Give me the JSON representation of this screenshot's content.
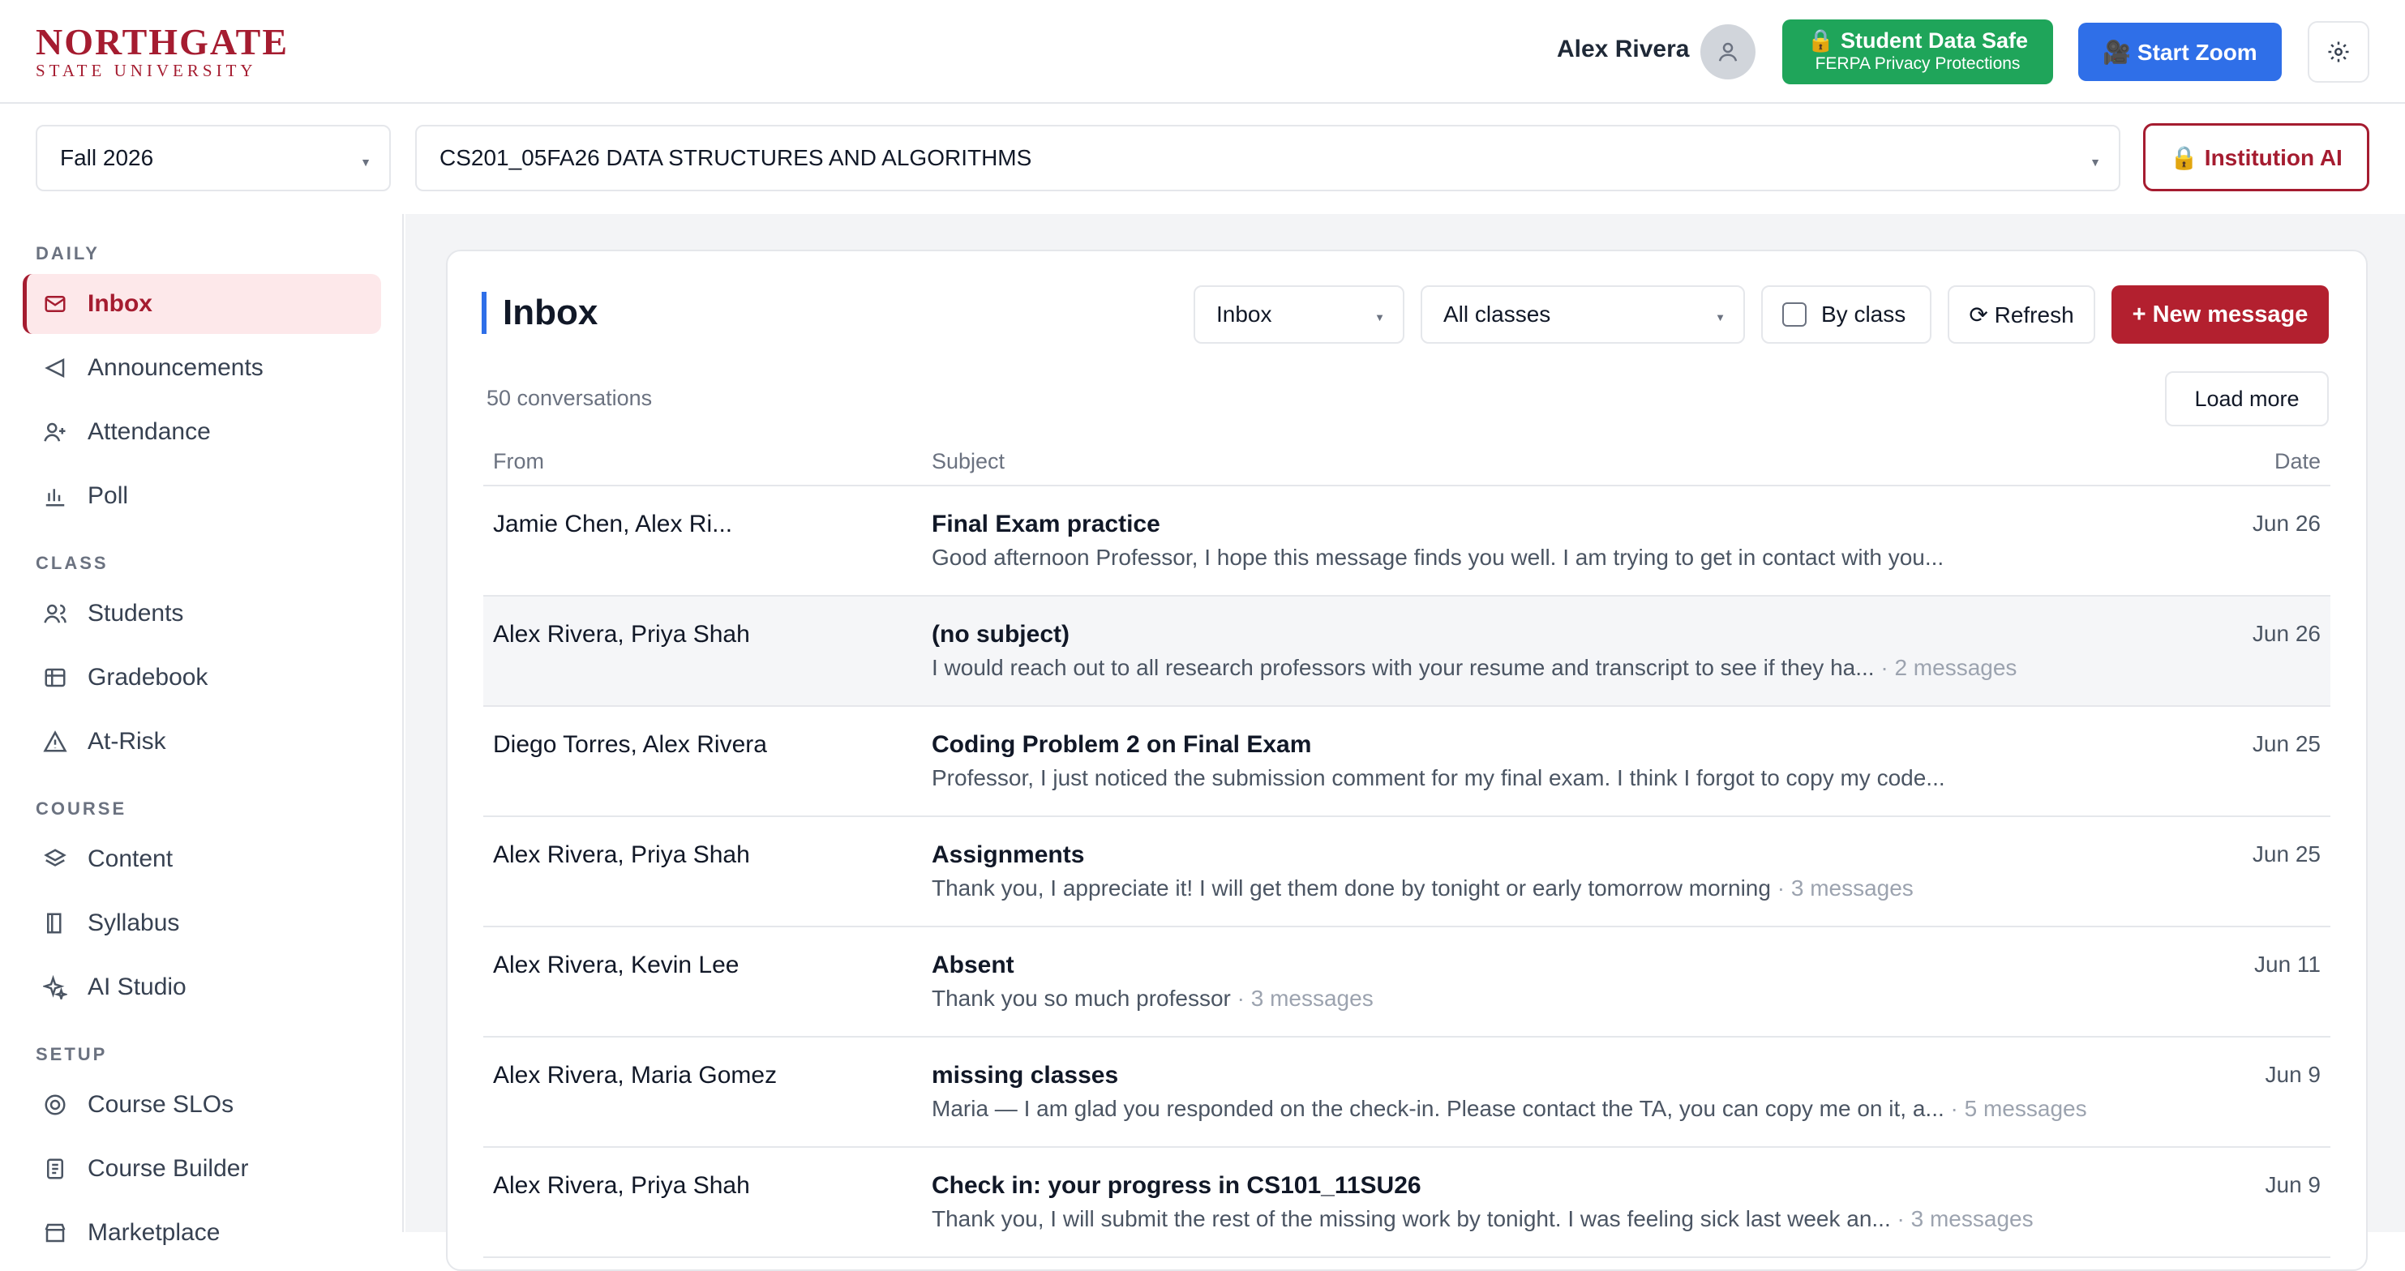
{
  "header": {
    "logo_line1": "NORTHGATE",
    "logo_line2": "STATE UNIVERSITY",
    "user_name": "Alex Rivera",
    "safe_title": "🔒 Student Data Safe",
    "safe_sub": "FERPA Privacy Protections",
    "zoom_label": "🎥 Start Zoom"
  },
  "selectors": {
    "term": "Fall 2026",
    "course": "CS201_05FA26 DATA STRUCTURES AND ALGORITHMS",
    "institution_ai": "🔒 Institution AI"
  },
  "sidebar": {
    "sections": [
      {
        "label": "DAILY",
        "items": [
          {
            "label": "Inbox",
            "icon": "mail-icon",
            "active": true
          },
          {
            "label": "Announcements",
            "icon": "megaphone-icon"
          },
          {
            "label": "Attendance",
            "icon": "user-plus-icon"
          },
          {
            "label": "Poll",
            "icon": "bar-chart-icon"
          }
        ]
      },
      {
        "label": "CLASS",
        "items": [
          {
            "label": "Students",
            "icon": "users-icon"
          },
          {
            "label": "Gradebook",
            "icon": "table-icon"
          },
          {
            "label": "At-Risk",
            "icon": "warning-icon"
          }
        ]
      },
      {
        "label": "COURSE",
        "items": [
          {
            "label": "Content",
            "icon": "layers-icon"
          },
          {
            "label": "Syllabus",
            "icon": "book-icon"
          },
          {
            "label": "AI Studio",
            "icon": "sparkle-icon"
          }
        ]
      },
      {
        "label": "SETUP",
        "items": [
          {
            "label": "Course SLOs",
            "icon": "target-icon"
          },
          {
            "label": "Course Builder",
            "icon": "document-icon"
          },
          {
            "label": "Marketplace",
            "icon": "store-icon"
          }
        ]
      }
    ]
  },
  "inbox": {
    "title": "Inbox",
    "box_filter": "Inbox",
    "class_filter": "All classes",
    "by_class_label": "By class",
    "refresh_label": "⟳ Refresh",
    "new_message_label": "+ New message",
    "count_text": "50 conversations",
    "load_more_label": "Load more",
    "columns": {
      "from": "From",
      "subject": "Subject",
      "date": "Date"
    },
    "rows": [
      {
        "from": "Jamie Chen, Alex Ri...",
        "subject": "Final Exam practice",
        "preview": "Good afternoon Professor, I hope this message finds you well. I am trying to get in contact with you...",
        "count": "",
        "date": "Jun 26"
      },
      {
        "from": "Alex Rivera, Priya Shah",
        "subject": "(no subject)",
        "preview": "I would reach out to all research professors with your resume and transcript to see if they ha...",
        "count": " · 2 messages",
        "date": "Jun 26"
      },
      {
        "from": "Diego Torres, Alex Rivera",
        "subject": "Coding Problem 2 on Final Exam",
        "preview": "Professor, I just noticed the submission comment for my final exam. I think I forgot to copy my code...",
        "count": "",
        "date": "Jun 25"
      },
      {
        "from": "Alex Rivera, Priya Shah",
        "subject": "Assignments",
        "preview": "Thank you, I appreciate it! I will get them done by tonight or early tomorrow morning",
        "count": " · 3 messages",
        "date": "Jun 25"
      },
      {
        "from": "Alex Rivera, Kevin Lee",
        "subject": "Absent",
        "preview": "Thank you so much professor",
        "count": " · 3 messages",
        "date": "Jun 11"
      },
      {
        "from": "Alex Rivera, Maria Gomez",
        "subject": "missing classes",
        "preview": "Maria — I am glad you responded on the check-in. Please contact the TA, you can copy me on it, a...",
        "count": " · 5 messages",
        "date": "Jun 9"
      },
      {
        "from": "Alex Rivera, Priya Shah",
        "subject": "Check in: your progress in CS101_11SU26",
        "preview": "Thank you, I will submit the rest of the missing work by tonight. I was feeling sick last week an...",
        "count": " · 3 messages",
        "date": "Jun 9"
      }
    ]
  }
}
